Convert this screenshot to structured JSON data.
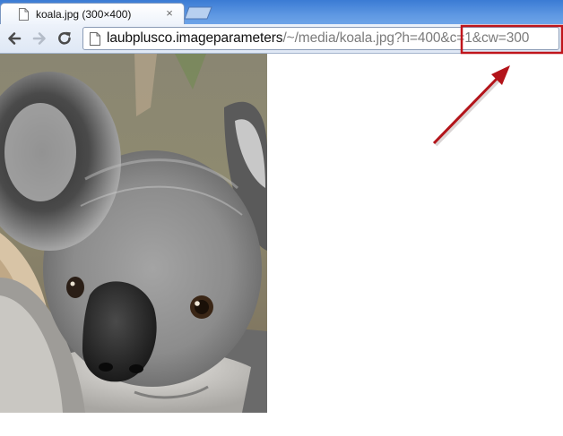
{
  "tab": {
    "title": "koala.jpg (300×400)",
    "close_glyph": "×",
    "favicon": "page-icon"
  },
  "toolbar": {
    "back_icon": "back-arrow-icon",
    "forward_icon": "forward-arrow-icon",
    "reload_icon": "reload-icon"
  },
  "address_bar": {
    "host": "laubplusco.imageparameters",
    "path": "/~/media/koala.jpg?h=400&c=1&cw=300",
    "highlighted_portion": "c=1&cw=300"
  },
  "content": {
    "image_subject": "koala",
    "image_width": 300,
    "image_height": 400
  },
  "annotation": {
    "box_color": "#c0161c",
    "arrow_color": "#c0161c"
  }
}
